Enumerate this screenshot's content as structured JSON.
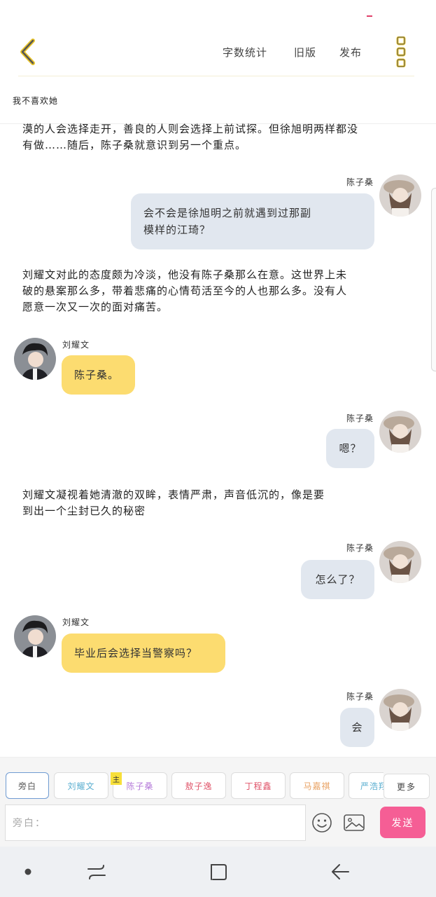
{
  "header": {
    "links": [
      "字数统计",
      "旧版",
      "发布"
    ],
    "chat_title": "我不喜欢她"
  },
  "messages": {
    "n1": [
      "漠的人会选择走开，善良的人则会选择上前试探。但徐旭明两样都没",
      "有做……随后，陈子桑就意识到另一个重点。"
    ],
    "m1": {
      "name": "陈子桑",
      "lines": [
        "会不会是徐旭明之前就遇到过那副",
        "模样的江琦？"
      ]
    },
    "n2": [
      "刘耀文对此的态度颇为冷淡，他没有陈子桑那么在意。这世界上未",
      "破的悬案那么多，带着悲痛的心情苟活至今的人也那么多。没有人",
      "愿意一次又一次的面对痛苦。"
    ],
    "m2": {
      "name": "刘耀文",
      "text": "陈子桑。"
    },
    "m3": {
      "name": "陈子桑",
      "text": "嗯？"
    },
    "n3": [
      "刘耀文凝视着她清澈的双眸，表情严肃，声音低沉的，像是要",
      "到出一个尘封已久的秘密"
    ],
    "m4": {
      "name": "陈子桑",
      "text": "怎么了？"
    },
    "m5": {
      "name": "刘耀文",
      "text": "毕业后会选择当警察吗？"
    },
    "m6": {
      "name": "陈子桑",
      "text": "会"
    }
  },
  "roles": [
    {
      "label": "旁白",
      "color": "#555555"
    },
    {
      "label": "刘耀文",
      "color": "#5aaed0"
    },
    {
      "label": "陈子桑",
      "color": "#b57ad9"
    },
    {
      "label": "敖子逸",
      "color": "#e0566b"
    },
    {
      "label": "丁程鑫",
      "color": "#e0566b"
    },
    {
      "label": "马嘉祺",
      "color": "#e8a060"
    },
    {
      "label": "严浩翔",
      "color": "#5aaed0"
    }
  ],
  "main_badge": "主",
  "more_label": "更多",
  "input": {
    "placeholder": "旁白："
  },
  "send_label": "发送",
  "colors": {
    "accent_yellow": "#fcdc70",
    "bubble_blue": "#e1e7ef",
    "send_pink": "#f55e95"
  }
}
